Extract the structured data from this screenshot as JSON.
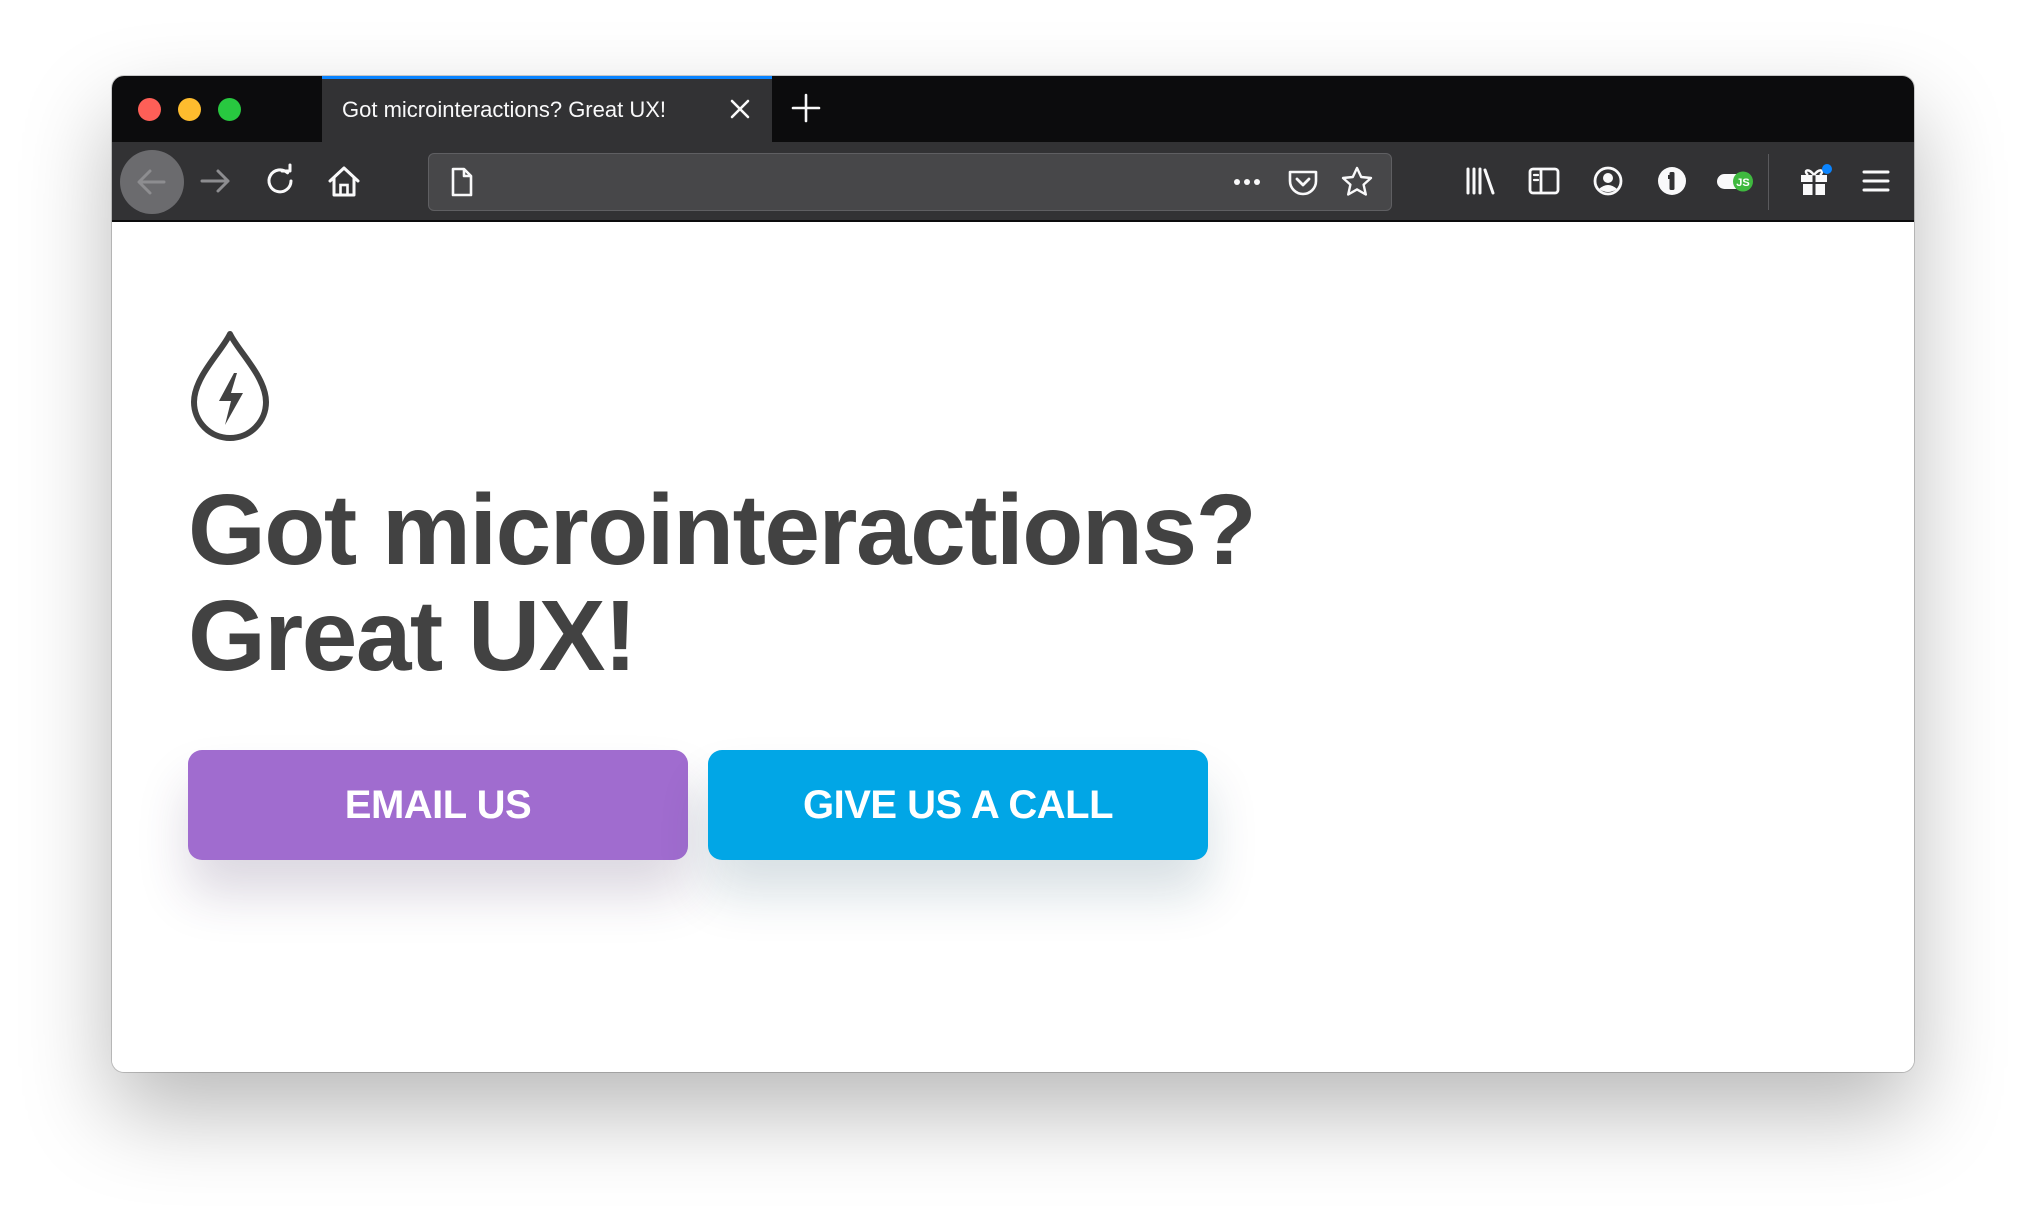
{
  "browser": {
    "window_controls": [
      "close",
      "minimize",
      "zoom"
    ],
    "tabs": [
      {
        "title": "Got microinteractions? Great UX!",
        "active": true
      }
    ],
    "new_tab_icon": "plus-icon",
    "tab_accent_color": "#0a84ff",
    "address_bar": {
      "value": "",
      "page_icon": "page-icon",
      "actions": [
        "more-actions-icon",
        "pocket-icon",
        "bookmark-star-icon"
      ]
    },
    "nav_icons": [
      "back-arrow-icon",
      "forward-arrow-icon",
      "reload-icon",
      "home-icon"
    ],
    "toolbar_icons": [
      "library-icon",
      "sidebar-icon",
      "account-icon",
      "password-manager-icon",
      "js-toggle-icon",
      "gift-icon",
      "hamburger-menu-icon"
    ]
  },
  "page": {
    "logo_icon": "lightning-drop-icon",
    "heading_line1": "Got microinteractions?",
    "heading_line2": "Great UX!",
    "heading_color": "#424242",
    "buttons": {
      "email": {
        "label": "EMAIL US",
        "color": "#a06ccf"
      },
      "call": {
        "label": "GIVE US A CALL",
        "color": "#01a6e6"
      }
    }
  }
}
